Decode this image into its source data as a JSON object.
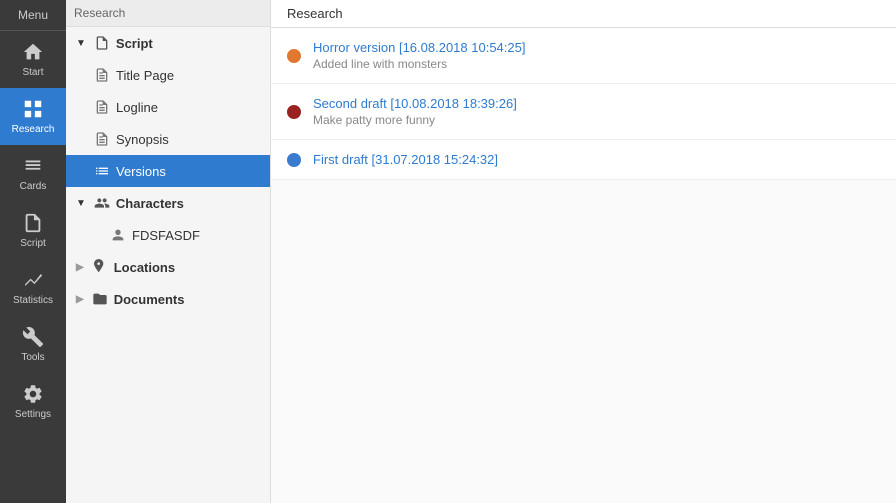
{
  "iconSidebar": {
    "menuLabel": "Menu",
    "items": [
      {
        "id": "start",
        "label": "Start",
        "icon": "home"
      },
      {
        "id": "research",
        "label": "Research",
        "icon": "research",
        "active": true
      },
      {
        "id": "cards",
        "label": "Cards",
        "icon": "cards"
      },
      {
        "id": "script",
        "label": "Script",
        "icon": "script"
      },
      {
        "id": "statistics",
        "label": "Statistics",
        "icon": "statistics"
      },
      {
        "id": "tools",
        "label": "Tools",
        "icon": "tools"
      },
      {
        "id": "settings",
        "label": "Settings",
        "icon": "settings"
      }
    ]
  },
  "treeSidebar": {
    "header": "Research",
    "sections": [
      {
        "id": "script",
        "label": "Script",
        "icon": "script",
        "expanded": true,
        "children": [
          {
            "id": "title-page",
            "label": "Title Page",
            "icon": "page"
          },
          {
            "id": "logline",
            "label": "Logline",
            "icon": "page"
          },
          {
            "id": "synopsis",
            "label": "Synopsis",
            "icon": "page"
          },
          {
            "id": "versions",
            "label": "Versions",
            "icon": "list",
            "active": true
          }
        ]
      },
      {
        "id": "characters",
        "label": "Characters",
        "icon": "characters",
        "expanded": true,
        "children": [
          {
            "id": "fdsfasdf",
            "label": "FDSFASDF",
            "icon": "person"
          }
        ]
      },
      {
        "id": "locations",
        "label": "Locations",
        "icon": "locations",
        "expanded": false,
        "children": []
      },
      {
        "id": "documents",
        "label": "Documents",
        "icon": "documents",
        "expanded": false,
        "children": []
      }
    ]
  },
  "mainContent": {
    "header": "Research",
    "versions": [
      {
        "id": "v1",
        "title": "Horror version [16.08.2018 10:54:25]",
        "subtitle": "Added line with monsters",
        "dotColor": "#e07830"
      },
      {
        "id": "v2",
        "title": "Second draft [10.08.2018 18:39:26]",
        "subtitle": "Make patty more funny",
        "dotColor": "#9b2222"
      },
      {
        "id": "v3",
        "title": "First draft [31.07.2018 15:24:32]",
        "subtitle": "",
        "dotColor": "#3a7bcf"
      }
    ],
    "deleteIconChar": "🗑"
  }
}
